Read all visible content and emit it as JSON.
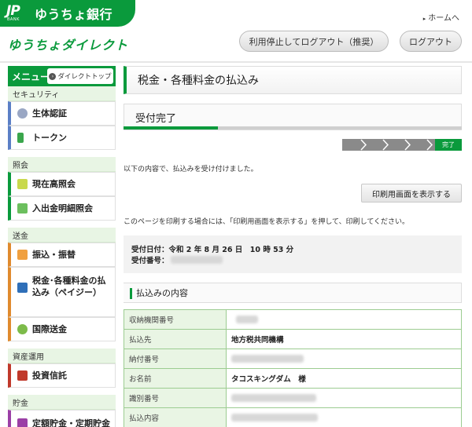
{
  "colors": {
    "brand_green": "#0a9a3c",
    "light_green": "#e8f5e4",
    "table_border": "#9ccc91"
  },
  "header": {
    "logo_mark": "JP",
    "logo_sub": "BANK",
    "bank_name": "ゆうちょ銀行",
    "home_link": "ホームへ",
    "service_logo": "ゆうちょダイレクト",
    "stop_logout_label": "利用停止してログアウト（推奨）",
    "logout_label": "ログアウト"
  },
  "sidebar": {
    "menu_label": "メニュー",
    "direct_top_label": "ダイレクトトップ",
    "sections": [
      {
        "category": "セキュリティ",
        "items": [
          {
            "label": "生体認証",
            "icon": "fingerprint-icon"
          },
          {
            "label": "トークン",
            "icon": "token-icon"
          }
        ]
      },
      {
        "category": "照会",
        "items": [
          {
            "label": "現在高照会",
            "icon": "balance-icon"
          },
          {
            "label": "入出金明細照会",
            "icon": "statement-icon"
          }
        ]
      },
      {
        "category": "送金",
        "items": [
          {
            "label": "振込・振替",
            "icon": "transfer-icon"
          },
          {
            "label": "税金･各種料金の払込み（ペイジー）",
            "icon": "payeasy-icon"
          },
          {
            "label": "国際送金",
            "icon": "international-icon"
          }
        ]
      },
      {
        "category": "資産運用",
        "items": [
          {
            "label": "投資信託",
            "icon": "investment-icon"
          }
        ]
      },
      {
        "category": "貯金",
        "items": [
          {
            "label": "定額貯金・定期貯金",
            "icon": "savings-icon"
          }
        ]
      }
    ]
  },
  "main": {
    "page_title": "税金・各種料金の払込み",
    "progress_label": "受付完了",
    "progress_fraction": 0.28,
    "steps_done_label": "完了",
    "message1": "以下の内容で、払込みを受け付けました。",
    "print_button": "印刷用画面を表示する",
    "message2": "このページを印刷する場合には、「印刷用画面を表示する」を押して、印刷してください。",
    "receipt_date_label": "受付日付：令和 2 年 8 月 26 日　10 時 53 分",
    "receipt_no_label": "受付番号：",
    "section_title": "払込みの内容",
    "table": [
      {
        "key": "収納機関番号",
        "value": ""
      },
      {
        "key": "払込先",
        "value": "地方税共同機構"
      },
      {
        "key": "納付番号",
        "value": ""
      },
      {
        "key": "お名前",
        "value": "タコスキングダム　様"
      },
      {
        "key": "識別番号",
        "value": ""
      },
      {
        "key": "払込内容",
        "value": ""
      }
    ]
  }
}
